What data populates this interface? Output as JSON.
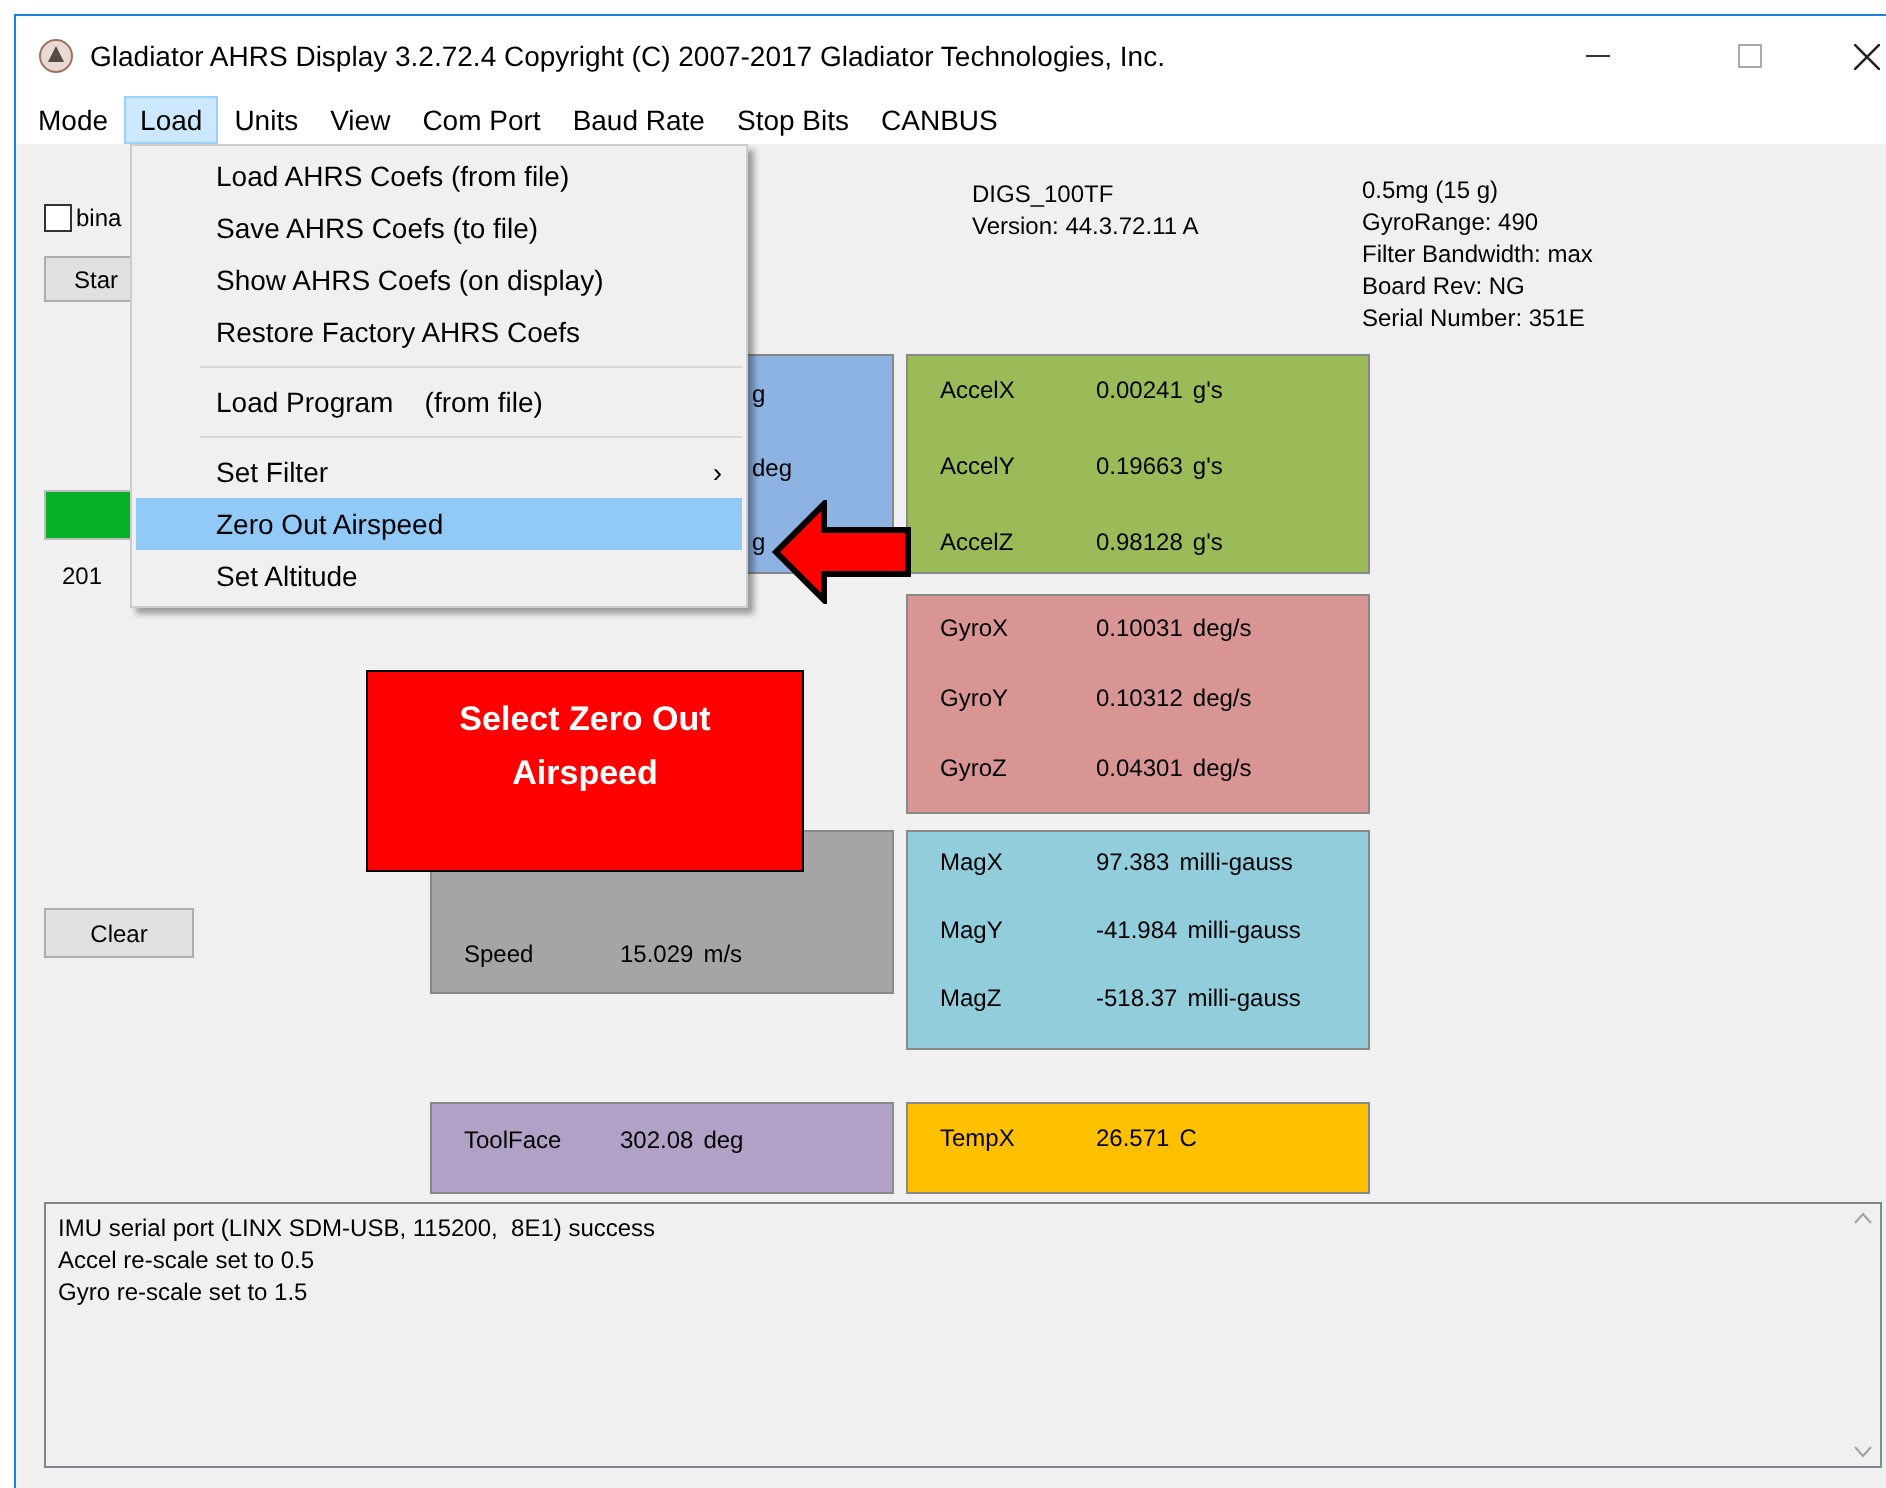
{
  "window": {
    "title": "Gladiator AHRS Display 3.2.72.4  Copyright (C) 2007-2017 Gladiator Technologies, Inc."
  },
  "menu_bar": [
    {
      "label": "Mode",
      "selected": false
    },
    {
      "label": "Load",
      "selected": true
    },
    {
      "label": "Units",
      "selected": false
    },
    {
      "label": "View",
      "selected": false
    },
    {
      "label": "Com Port",
      "selected": false
    },
    {
      "label": "Baud Rate",
      "selected": false
    },
    {
      "label": "Stop Bits",
      "selected": false
    },
    {
      "label": "CANBUS",
      "selected": false
    }
  ],
  "load_menu": [
    {
      "kind": "item",
      "label": "Load AHRS Coefs (from file)",
      "selected": false
    },
    {
      "kind": "item",
      "label": "Save AHRS Coefs (to file)",
      "selected": false
    },
    {
      "kind": "item",
      "label": "Show AHRS Coefs (on display)",
      "selected": false
    },
    {
      "kind": "item",
      "label": "Restore Factory AHRS Coefs",
      "selected": false
    },
    {
      "kind": "separator"
    },
    {
      "kind": "item",
      "label": "Load Program    (from file)",
      "selected": false
    },
    {
      "kind": "separator"
    },
    {
      "kind": "submenu",
      "label": "Set Filter",
      "arrow": "›",
      "selected": false
    },
    {
      "kind": "item",
      "label": "Zero Out Airspeed",
      "selected": true
    },
    {
      "kind": "item",
      "label": "Set Altitude",
      "selected": false
    }
  ],
  "left": {
    "binary_checkbox": {
      "label": "bina",
      "checked": false
    },
    "start_button": "Star",
    "reading": "201",
    "clear_button": "Clear"
  },
  "device": {
    "model": "DIGS_100TF",
    "version": "Version: 44.3.72.11 A"
  },
  "specs": [
    "0.5mg (15 g)",
    "GyroRange: 490",
    "Filter Bandwidth: max",
    "Board Rev: NG",
    "Serial Number: 351E"
  ],
  "attitude_panel": {
    "fragments": [
      "g",
      "deg",
      "g"
    ]
  },
  "panels": [
    {
      "kind": "accel",
      "color": "#9bbb59",
      "rows": [
        {
          "name": "AccelX",
          "value": "0.00241",
          "unit": "g's"
        },
        {
          "name": "AccelY",
          "value": "0.19663",
          "unit": "g's"
        },
        {
          "name": "AccelZ",
          "value": "0.98128",
          "unit": "g's"
        }
      ]
    },
    {
      "kind": "gyro",
      "color": "#d99594",
      "rows": [
        {
          "name": "GyroX",
          "value": "0.10031",
          "unit": "deg/s"
        },
        {
          "name": "GyroY",
          "value": "0.10312",
          "unit": "deg/s"
        },
        {
          "name": "GyroZ",
          "value": "0.04301",
          "unit": "deg/s"
        }
      ]
    },
    {
      "kind": "mag",
      "color": "#92cddc",
      "rows": [
        {
          "name": "MagX",
          "value": "97.383",
          "unit": "milli-gauss"
        },
        {
          "name": "MagY",
          "value": "-41.984",
          "unit": "milli-gauss"
        },
        {
          "name": "MagZ",
          "value": "-518.37",
          "unit": "milli-gauss"
        }
      ]
    },
    {
      "kind": "temp",
      "color": "#ffc000",
      "rows": [
        {
          "name": "TempX",
          "value": "26.571",
          "unit": "C"
        }
      ]
    }
  ],
  "speed_panel": {
    "color": "#a5a5a5",
    "rows": [
      {
        "name": "Speed",
        "value": "15.029",
        "unit": "m/s"
      }
    ]
  },
  "toolface_panel": {
    "color": "#b2a1c7",
    "rows": [
      {
        "name": "ToolFace",
        "value": "302.08",
        "unit": "deg"
      }
    ]
  },
  "log": [
    "IMU serial port (LINX SDM-USB, 115200,  8E1) success",
    "Accel re-scale set to 0.5",
    "Gyro re-scale set to 1.5"
  ],
  "callout": "Select Zero Out Airspeed"
}
